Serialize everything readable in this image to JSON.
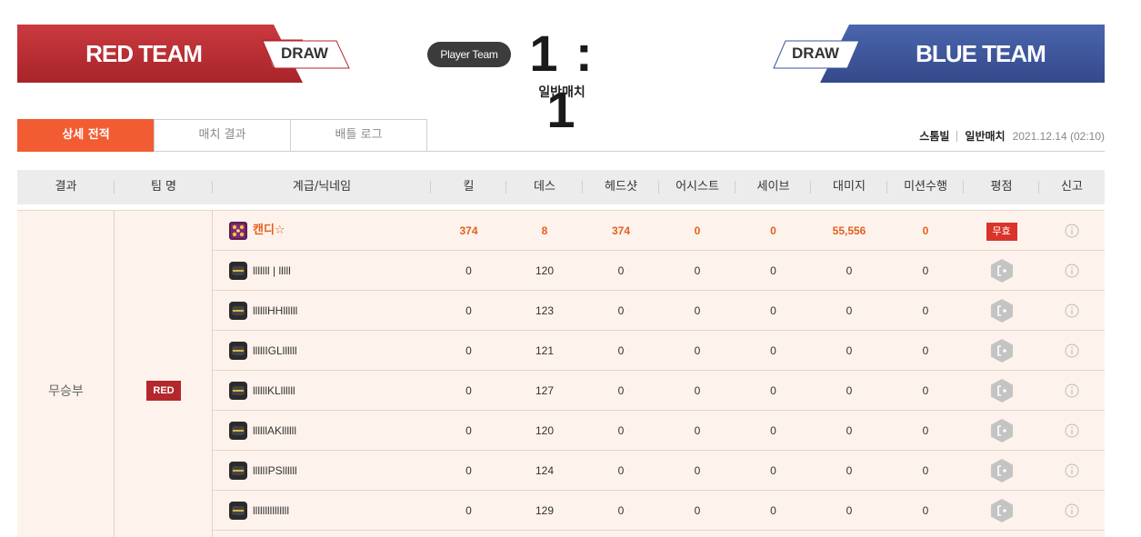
{
  "header": {
    "red_team": "RED TEAM",
    "red_result": "DRAW",
    "blue_team": "BLUE TEAM",
    "blue_result": "DRAW",
    "player_team_label": "Player Team",
    "score": "1 : 1",
    "match_type": "일반매치",
    "colors": {
      "red": "#b3272d",
      "blue": "#3b5498",
      "accent": "#f25c33"
    }
  },
  "tabs": [
    {
      "label": "상세 전적",
      "active": true
    },
    {
      "label": "매치 결과",
      "active": false
    },
    {
      "label": "배틀 로그",
      "active": false
    }
  ],
  "meta": {
    "map": "스톰빌",
    "mode": "일반매치",
    "datetime": "2021.12.14 (02:10)"
  },
  "table": {
    "headers": [
      "결과",
      "팀 명",
      "계급/닉네임",
      "킬",
      "데스",
      "헤드샷",
      "어시스트",
      "세이브",
      "대미지",
      "미션수행",
      "평점",
      "신고"
    ],
    "result": "무승부",
    "team_badge": "RED",
    "rows": [
      {
        "nick": "캔디☆",
        "kill": "374",
        "death": "8",
        "headshot": "374",
        "assist": "0",
        "save": "0",
        "damage": "55,556",
        "mission": "0",
        "rating": "무효",
        "rank_icon": "special-rank-icon",
        "highlight": true
      },
      {
        "nick": "lllllll | lllll",
        "kill": "0",
        "death": "120",
        "headshot": "0",
        "assist": "0",
        "save": "0",
        "damage": "0",
        "mission": "0",
        "rating_icon": "hex-rating-icon",
        "rank_icon": "rank-icon"
      },
      {
        "nick": "llllllHHllllll",
        "kill": "0",
        "death": "123",
        "headshot": "0",
        "assist": "0",
        "save": "0",
        "damage": "0",
        "mission": "0",
        "rating_icon": "hex-rating-icon",
        "rank_icon": "rank-icon"
      },
      {
        "nick": "lllllIGLllllll",
        "kill": "0",
        "death": "121",
        "headshot": "0",
        "assist": "0",
        "save": "0",
        "damage": "0",
        "mission": "0",
        "rating_icon": "hex-rating-icon",
        "rank_icon": "rank-icon"
      },
      {
        "nick": "llllllKLllllll",
        "kill": "0",
        "death": "127",
        "headshot": "0",
        "assist": "0",
        "save": "0",
        "damage": "0",
        "mission": "0",
        "rating_icon": "hex-rating-icon",
        "rank_icon": "rank-icon"
      },
      {
        "nick": "llllllAKllllll",
        "kill": "0",
        "death": "120",
        "headshot": "0",
        "assist": "0",
        "save": "0",
        "damage": "0",
        "mission": "0",
        "rating_icon": "hex-rating-icon",
        "rank_icon": "rank-icon"
      },
      {
        "nick": "lllllIPSllllll",
        "kill": "0",
        "death": "124",
        "headshot": "0",
        "assist": "0",
        "save": "0",
        "damage": "0",
        "mission": "0",
        "rating_icon": "hex-rating-icon",
        "rank_icon": "rank-icon"
      },
      {
        "nick": "lllllllllllllll",
        "kill": "0",
        "death": "129",
        "headshot": "0",
        "assist": "0",
        "save": "0",
        "damage": "0",
        "mission": "0",
        "rating_icon": "hex-rating-icon",
        "rank_icon": "rank-icon"
      }
    ]
  }
}
